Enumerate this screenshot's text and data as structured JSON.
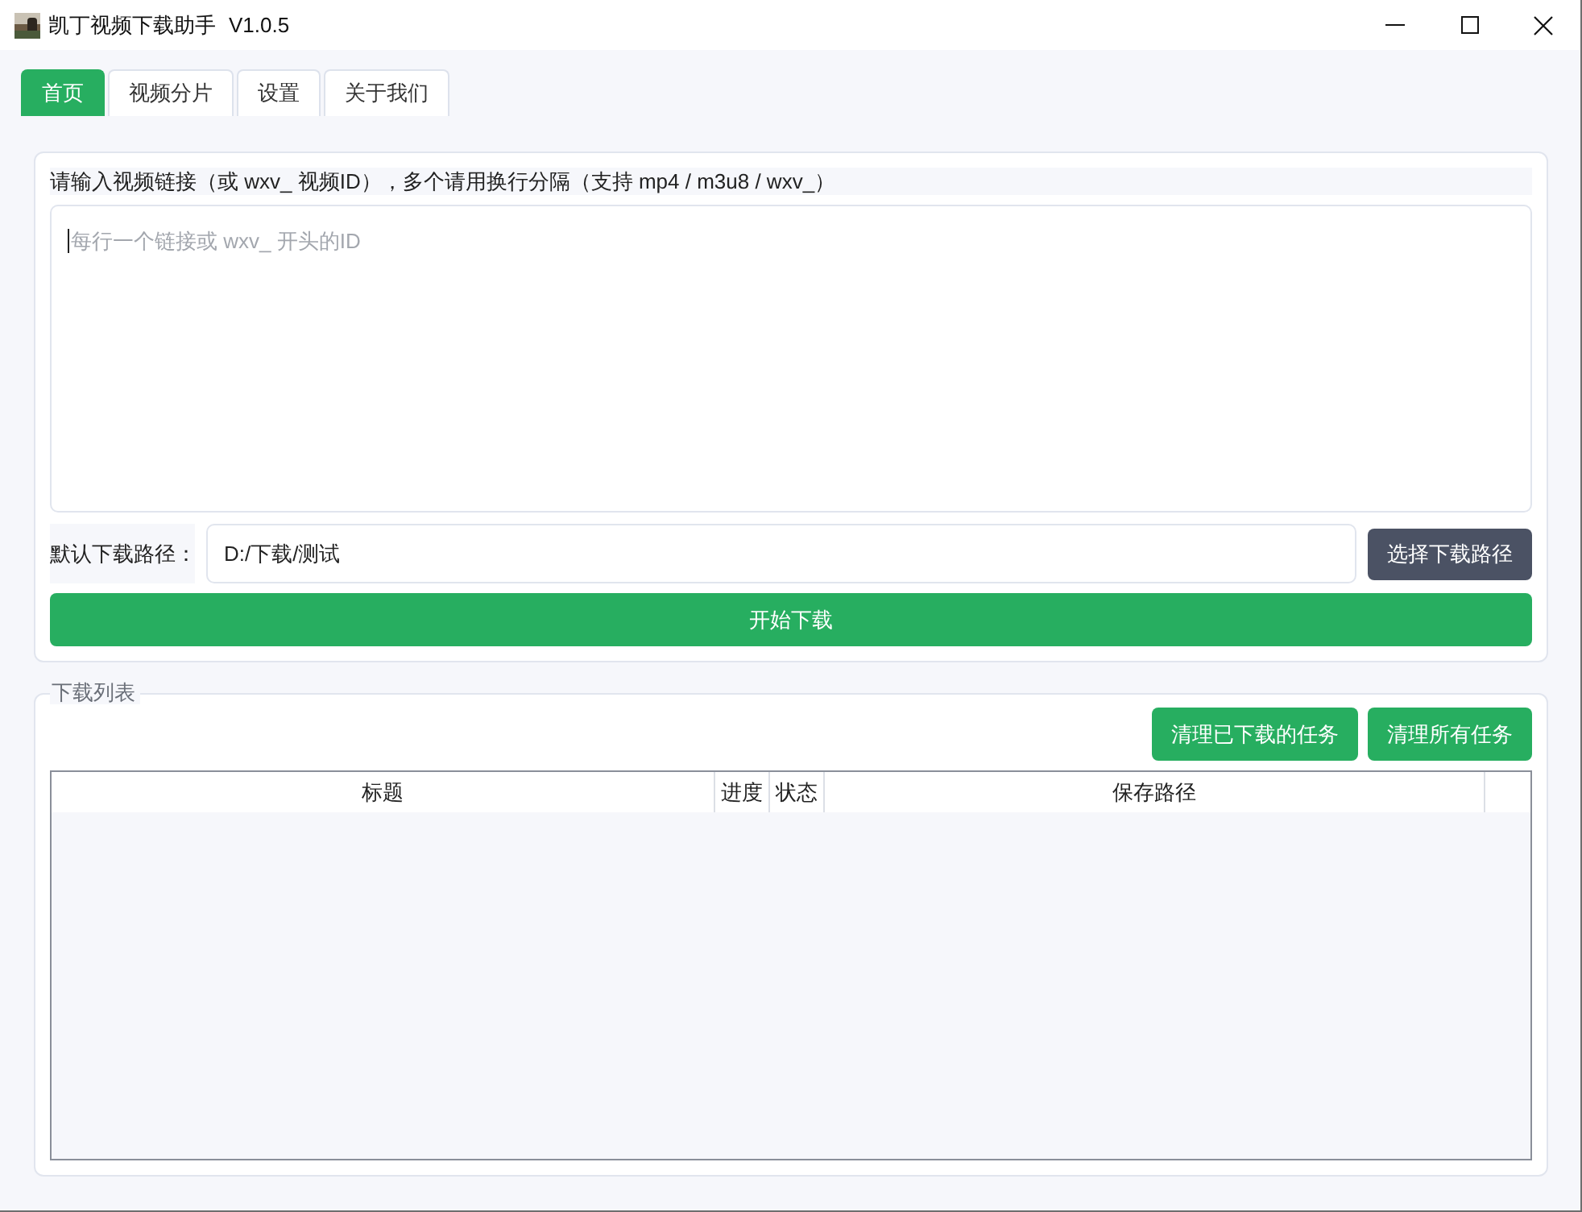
{
  "window": {
    "title": "凯丁视频下载助手",
    "version": "V1.0.5"
  },
  "tabs": [
    {
      "label": "首页",
      "selected": true
    },
    {
      "label": "视频分片",
      "selected": false
    },
    {
      "label": "设置",
      "selected": false
    },
    {
      "label": "关于我们",
      "selected": false
    }
  ],
  "link_input": {
    "label": "请输入视频链接（或 wxv_ 视频ID），多个请用换行分隔（支持 mp4 / m3u8 / wxv_）",
    "placeholder": "每行一个链接或 wxv_ 开头的ID"
  },
  "path": {
    "label": "默认下载路径：",
    "value": "D:/下载/测试",
    "button": "选择下载路径"
  },
  "start_button": "开始下载",
  "download_list": {
    "title": "下载列表",
    "buttons": [
      "清理已下载的任务",
      "清理所有任务"
    ],
    "table": {
      "columns": [
        "标题",
        "进度",
        "状态",
        "保存路径"
      ]
    }
  }
}
